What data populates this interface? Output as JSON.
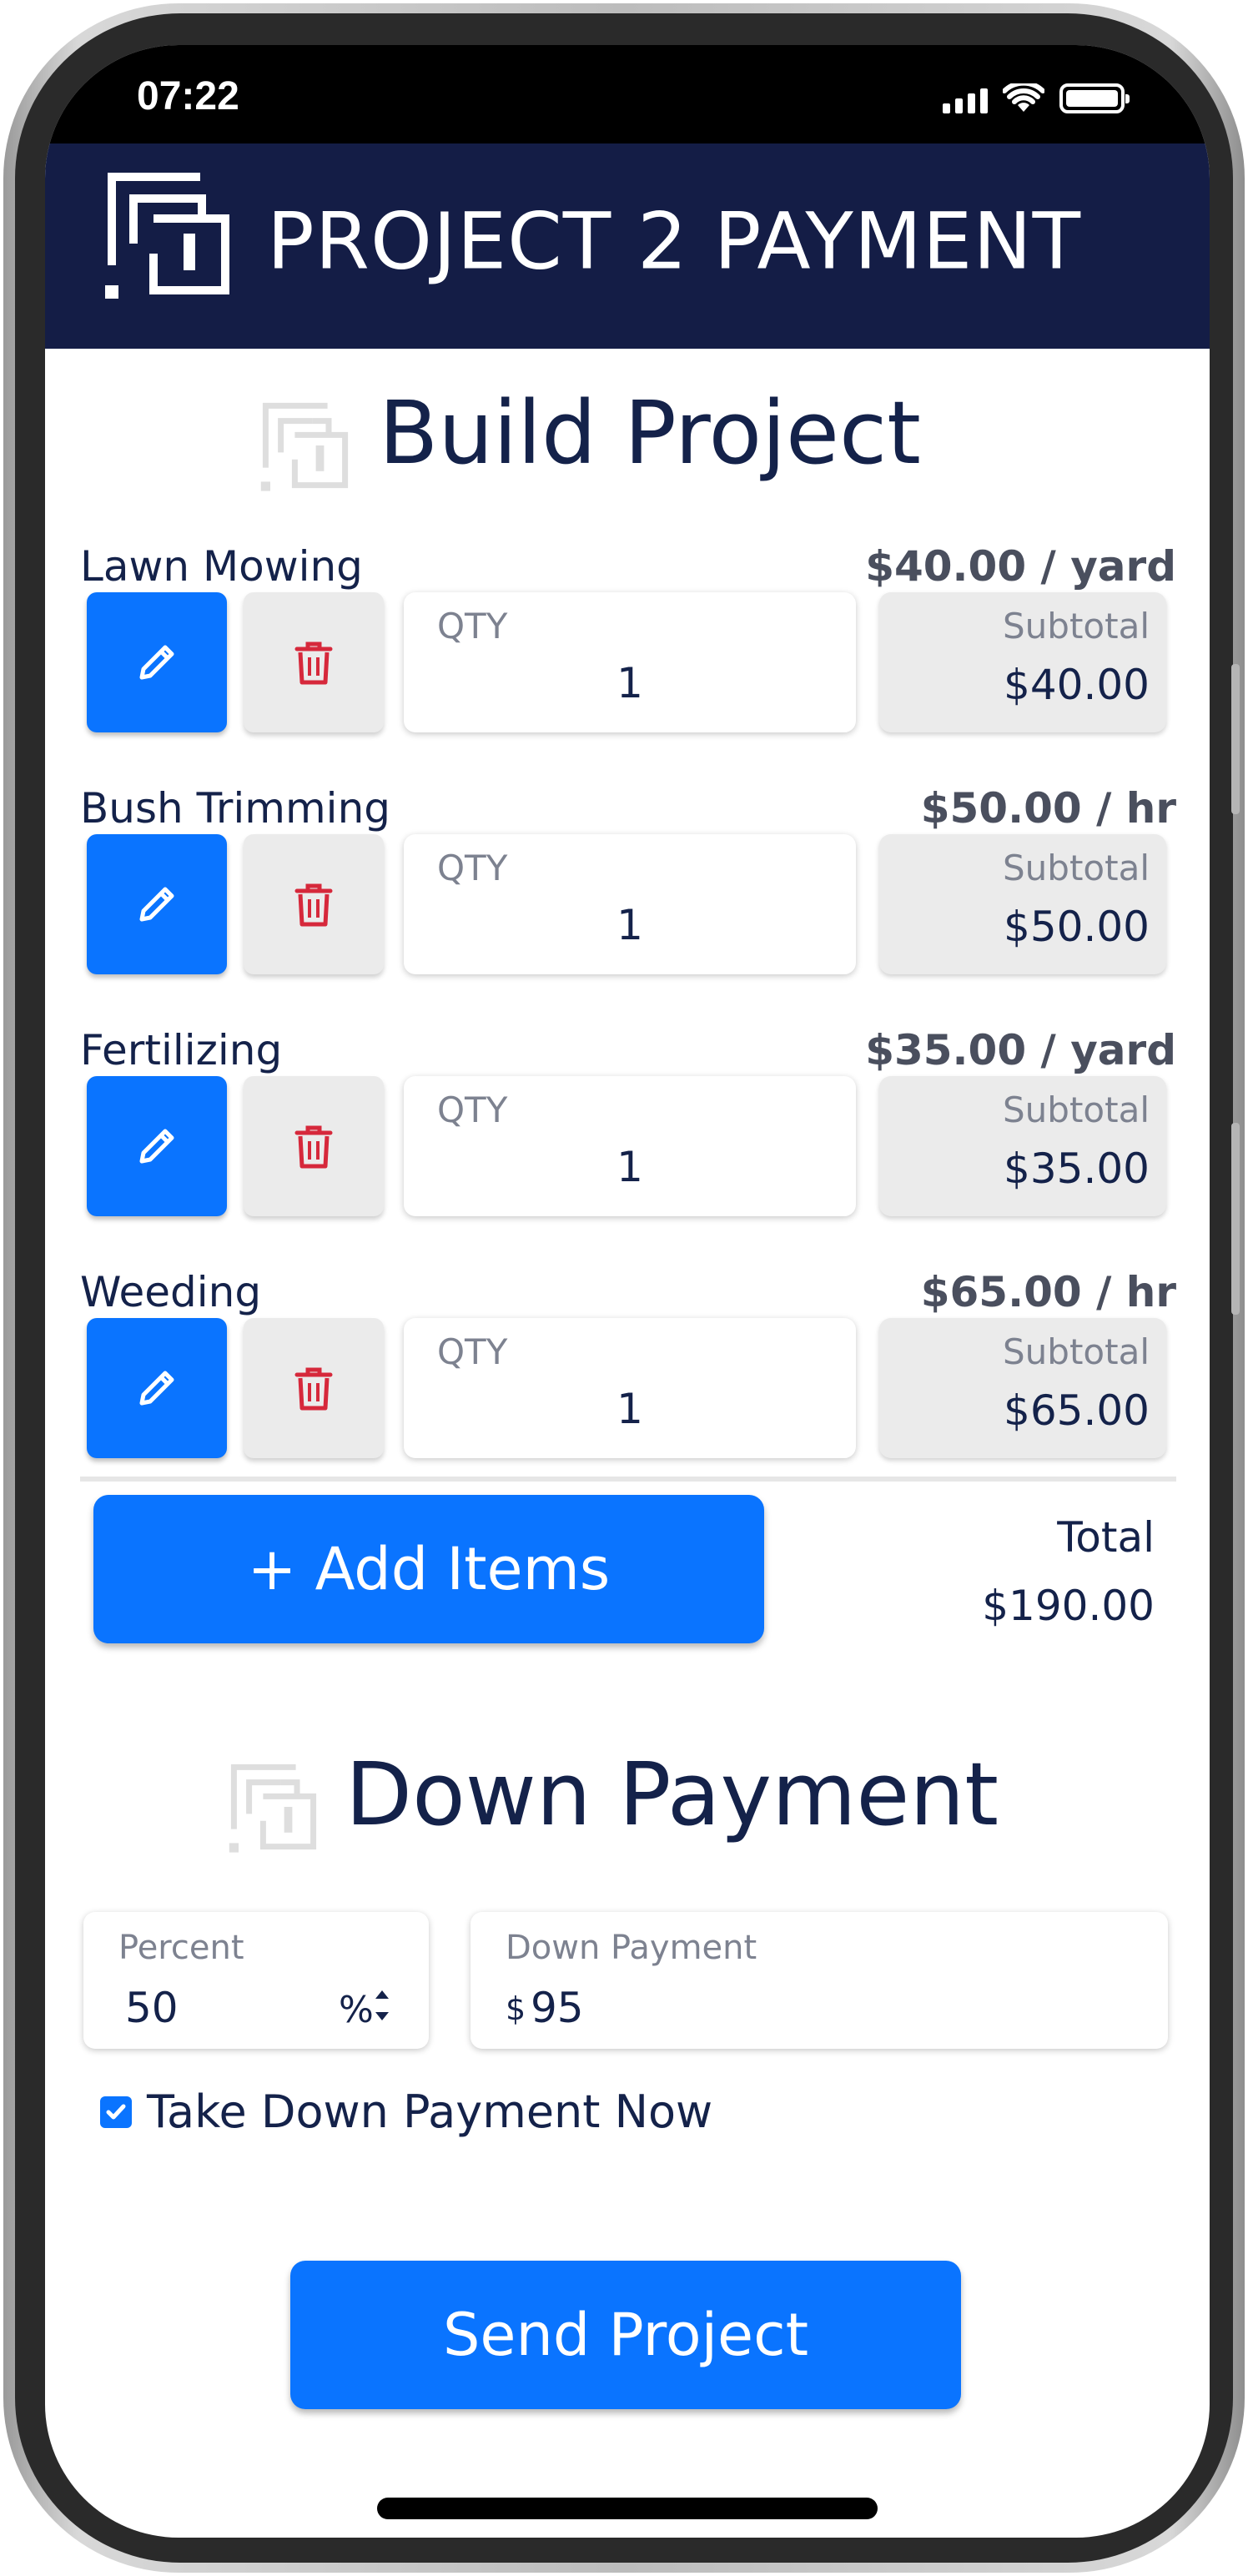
{
  "status_bar": {
    "time": "07:22"
  },
  "header": {
    "brand": "PROJECT 2 PAYMENT",
    "logo_icon": "p2p-logo-icon"
  },
  "build_section": {
    "title": "Build Project"
  },
  "items": [
    {
      "name": "Lawn Mowing",
      "rate": "$40.00 / yard",
      "qty_label": "QTY",
      "qty": "1",
      "subtotal_label": "Subtotal",
      "subtotal": "$40.00"
    },
    {
      "name": "Bush Trimming",
      "rate": "$50.00 / hr",
      "qty_label": "QTY",
      "qty": "1",
      "subtotal_label": "Subtotal",
      "subtotal": "$50.00"
    },
    {
      "name": "Fertilizing",
      "rate": "$35.00 / yard",
      "qty_label": "QTY",
      "qty": "1",
      "subtotal_label": "Subtotal",
      "subtotal": "$35.00"
    },
    {
      "name": "Weeding",
      "rate": "$65.00 / hr",
      "qty_label": "QTY",
      "qty": "1",
      "subtotal_label": "Subtotal",
      "subtotal": "$65.00"
    }
  ],
  "actions": {
    "add_items": "+ Add Items",
    "total_label": "Total",
    "total_value": "$190.00"
  },
  "down_payment_section": {
    "title": "Down Payment",
    "percent_label": "Percent",
    "percent_value": "50",
    "percent_suffix": "%",
    "amount_label": "Down Payment",
    "amount_prefix": "$",
    "amount_value": "95",
    "take_now_label": "Take Down Payment Now",
    "take_now_checked": true
  },
  "send_button": "Send Project",
  "colors": {
    "header_bg": "#141d46",
    "accent": "#0a74ff",
    "text": "#14224a",
    "delete": "#d6283b"
  }
}
